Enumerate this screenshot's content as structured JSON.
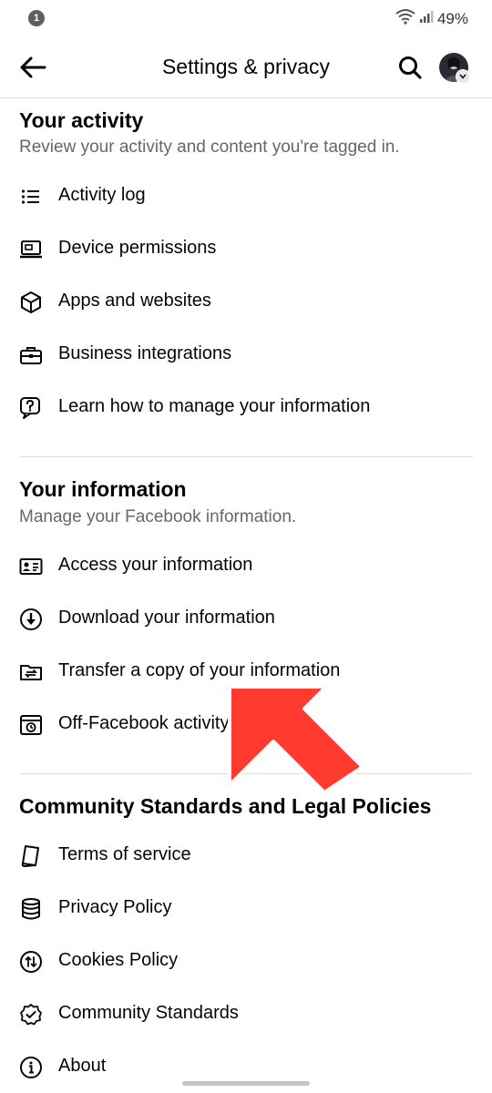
{
  "status_bar": {
    "notification_count": "1",
    "battery": "49%"
  },
  "header": {
    "title": "Settings & privacy"
  },
  "your_activity": {
    "title": "Your activity",
    "subtitle": "Review your activity and content you're tagged in.",
    "items": [
      {
        "label": "Activity log",
        "icon": "list-icon"
      },
      {
        "label": "Device permissions",
        "icon": "device-icon"
      },
      {
        "label": "Apps and websites",
        "icon": "cube-icon"
      },
      {
        "label": "Business integrations",
        "icon": "briefcase-icon"
      },
      {
        "label": "Learn how to manage your information",
        "icon": "help-bubble-icon"
      }
    ]
  },
  "your_information": {
    "title": "Your information",
    "subtitle": "Manage your Facebook information.",
    "items": [
      {
        "label": "Access your information",
        "icon": "id-card-icon"
      },
      {
        "label": "Download your information",
        "icon": "download-icon"
      },
      {
        "label": "Transfer a copy of your information",
        "icon": "folder-transfer-icon"
      },
      {
        "label": "Off-Facebook activity",
        "icon": "browser-history-icon"
      }
    ]
  },
  "community": {
    "title": "Community Standards and Legal Policies",
    "items": [
      {
        "label": "Terms of service",
        "icon": "book-icon"
      },
      {
        "label": "Privacy Policy",
        "icon": "database-icon"
      },
      {
        "label": "Cookies Policy",
        "icon": "cookies-icon"
      },
      {
        "label": "Community Standards",
        "icon": "badge-check-icon"
      },
      {
        "label": "About",
        "icon": "info-icon"
      }
    ]
  },
  "colors": {
    "text": "#050505",
    "secondary": "#65676b",
    "divider": "#dadde1",
    "arrow": "#ff3b30"
  }
}
